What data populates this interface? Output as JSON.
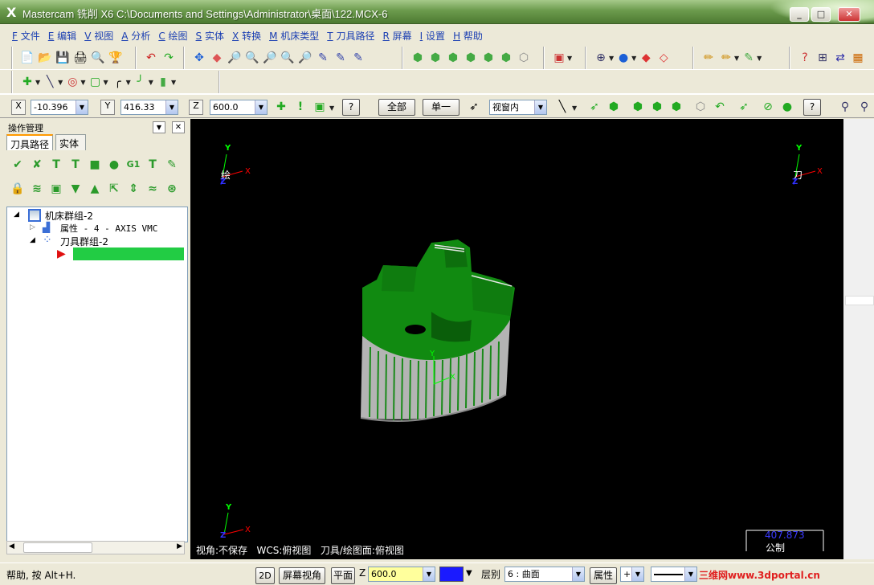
{
  "window": {
    "title": "Mastercam 铣削 X6  C:\\Documents and Settings\\Administrator\\桌面\\122.MCX-6",
    "logo_glyph": "X",
    "minimize": "_",
    "maximize": "□",
    "close": "✕"
  },
  "menu": [
    {
      "key": "F",
      "label": "文件"
    },
    {
      "key": "E",
      "label": "编辑"
    },
    {
      "key": "V",
      "label": "视图"
    },
    {
      "key": "A",
      "label": "分析"
    },
    {
      "key": "C",
      "label": "绘图"
    },
    {
      "key": "S",
      "label": "实体"
    },
    {
      "key": "X",
      "label": "转换"
    },
    {
      "key": "M",
      "label": "机床类型"
    },
    {
      "key": "T",
      "label": "刀具路径"
    },
    {
      "key": "R",
      "label": "屏幕"
    },
    {
      "key": "I",
      "label": "设置"
    },
    {
      "key": "H",
      "label": "帮助"
    }
  ],
  "coords": {
    "x_label": "X",
    "x_value": "-10.396",
    "y_label": "Y",
    "y_value": "416.33",
    "z_label": "Z",
    "z_value": "600.0",
    "all_button": "全部",
    "single_button": "单一",
    "window_select": "视窗内",
    "help_glyph": "?"
  },
  "panel": {
    "title": "操作管理",
    "tab_toolpath": "刀具路径",
    "tab_solid": "实体",
    "g1_label": "G1",
    "tree": {
      "root": "机床群组-2",
      "properties": "属性 - 4 - AXIS VMC",
      "toolgroup": "刀具群组-2"
    }
  },
  "viewport": {
    "axis_y": "Y",
    "axis_x": "X",
    "axis_z": "Z",
    "tl_label": "绘",
    "tr_label": "刀",
    "info_view": "视角:不保存",
    "info_wcs": "WCS:俯视图",
    "info_tool": "刀具/绘图面:俯视图",
    "scale_value": "407.873",
    "scale_unit": "公制"
  },
  "status": {
    "help_text": "帮助, 按 Alt+H.",
    "btn_2d": "2D",
    "btn_screen_view": "屏幕视角",
    "btn_plane": "平面",
    "z_label": "Z",
    "z_value": "600.0",
    "layer_label": "层别",
    "layer_value": "6 : 曲面",
    "attr_label": "属性",
    "watermark": "三维网www.3dportal.cn"
  },
  "colors": {
    "viewport_bg": "#000000",
    "part_green": "#118a11",
    "part_gray": "#b4b4b4",
    "selection_green": "#22cc44",
    "menu_text": "#1b3fb2",
    "scale_blue": "#3a3aff"
  }
}
